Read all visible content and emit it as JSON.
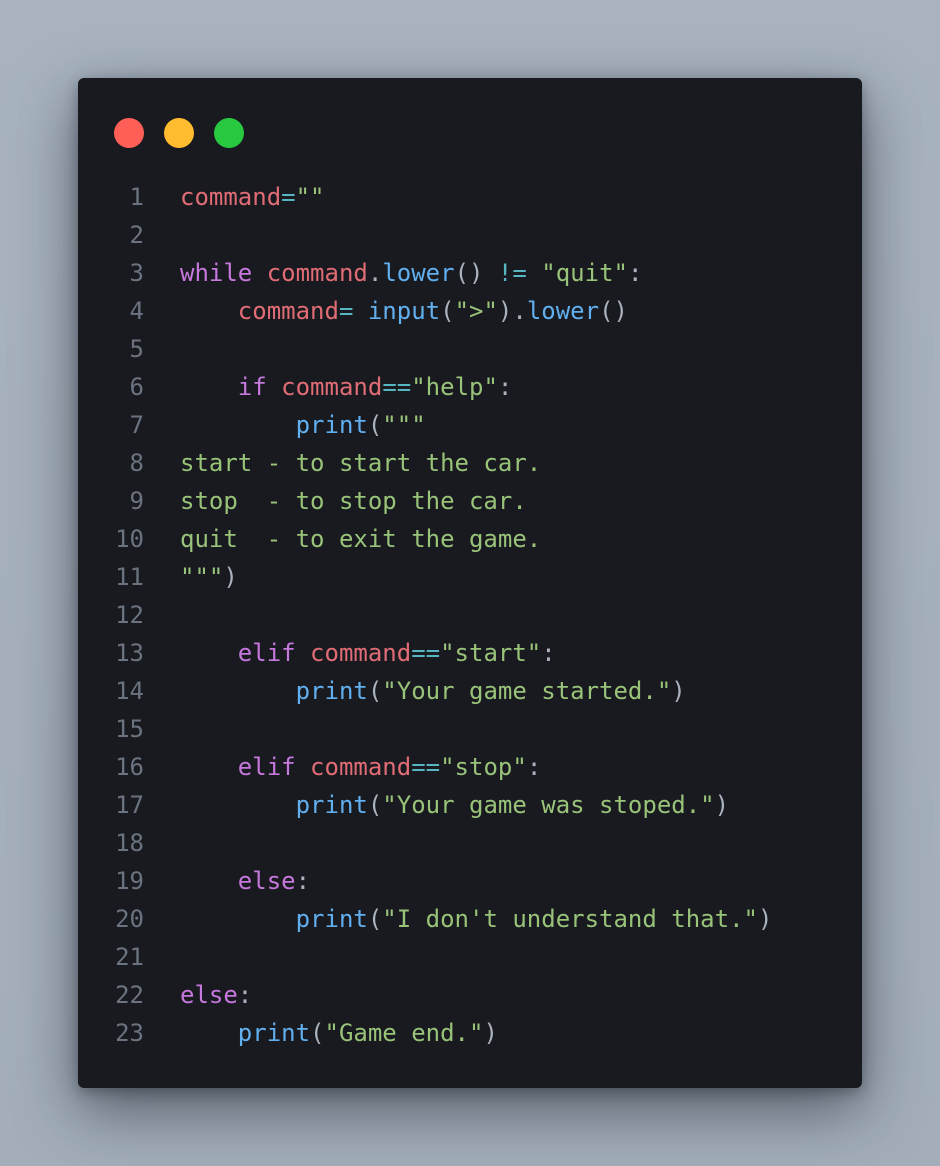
{
  "window": {
    "controls": [
      {
        "name": "close",
        "color": "#ff5f57"
      },
      {
        "name": "minimize",
        "color": "#febc2e"
      },
      {
        "name": "maximize",
        "color": "#28c840"
      }
    ]
  },
  "colors": {
    "background": "#a8b3bf",
    "editor_bg": "#181a1f",
    "line_number": "#6b7380",
    "keyword": "#c678dd",
    "variable": "#e06c75",
    "function": "#61afef",
    "string": "#98c379",
    "operator": "#56b6c2",
    "punctuation": "#abb2bf"
  },
  "code": {
    "language": "python",
    "lines": [
      {
        "n": "1",
        "tokens": [
          [
            "var",
            "command"
          ],
          [
            "op",
            "="
          ],
          [
            "str",
            "\"\""
          ]
        ]
      },
      {
        "n": "2",
        "tokens": []
      },
      {
        "n": "3",
        "tokens": [
          [
            "kw",
            "while"
          ],
          [
            "pn",
            " "
          ],
          [
            "var",
            "command"
          ],
          [
            "pn",
            "."
          ],
          [
            "fn",
            "lower"
          ],
          [
            "pn",
            "() "
          ],
          [
            "op",
            "!="
          ],
          [
            "pn",
            " "
          ],
          [
            "str",
            "\"quit\""
          ],
          [
            "pn",
            ":"
          ]
        ]
      },
      {
        "n": "4",
        "tokens": [
          [
            "pn",
            "    "
          ],
          [
            "var",
            "command"
          ],
          [
            "op",
            "="
          ],
          [
            "pn",
            " "
          ],
          [
            "fn",
            "input"
          ],
          [
            "pn",
            "("
          ],
          [
            "str",
            "\">\""
          ],
          [
            "pn",
            ")."
          ],
          [
            "fn",
            "lower"
          ],
          [
            "pn",
            "()"
          ]
        ]
      },
      {
        "n": "5",
        "tokens": []
      },
      {
        "n": "6",
        "tokens": [
          [
            "pn",
            "    "
          ],
          [
            "kw",
            "if"
          ],
          [
            "pn",
            " "
          ],
          [
            "var",
            "command"
          ],
          [
            "op",
            "=="
          ],
          [
            "str",
            "\"help\""
          ],
          [
            "pn",
            ":"
          ]
        ]
      },
      {
        "n": "7",
        "tokens": [
          [
            "pn",
            "        "
          ],
          [
            "fn",
            "print"
          ],
          [
            "pn",
            "("
          ],
          [
            "str",
            "\"\"\""
          ]
        ]
      },
      {
        "n": "8",
        "tokens": [
          [
            "str",
            "start - to start the car."
          ]
        ]
      },
      {
        "n": "9",
        "tokens": [
          [
            "str",
            "stop  - to stop the car."
          ]
        ]
      },
      {
        "n": "10",
        "tokens": [
          [
            "str",
            "quit  - to exit the game."
          ]
        ]
      },
      {
        "n": "11",
        "tokens": [
          [
            "str",
            "\"\"\""
          ],
          [
            "pn",
            ")"
          ]
        ]
      },
      {
        "n": "12",
        "tokens": []
      },
      {
        "n": "13",
        "tokens": [
          [
            "pn",
            "    "
          ],
          [
            "kw",
            "elif"
          ],
          [
            "pn",
            " "
          ],
          [
            "var",
            "command"
          ],
          [
            "op",
            "=="
          ],
          [
            "str",
            "\"start\""
          ],
          [
            "pn",
            ":"
          ]
        ]
      },
      {
        "n": "14",
        "tokens": [
          [
            "pn",
            "        "
          ],
          [
            "fn",
            "print"
          ],
          [
            "pn",
            "("
          ],
          [
            "str",
            "\"Your game started.\""
          ],
          [
            "pn",
            ")"
          ]
        ]
      },
      {
        "n": "15",
        "tokens": []
      },
      {
        "n": "16",
        "tokens": [
          [
            "pn",
            "    "
          ],
          [
            "kw",
            "elif"
          ],
          [
            "pn",
            " "
          ],
          [
            "var",
            "command"
          ],
          [
            "op",
            "=="
          ],
          [
            "str",
            "\"stop\""
          ],
          [
            "pn",
            ":"
          ]
        ]
      },
      {
        "n": "17",
        "tokens": [
          [
            "pn",
            "        "
          ],
          [
            "fn",
            "print"
          ],
          [
            "pn",
            "("
          ],
          [
            "str",
            "\"Your game was stoped.\""
          ],
          [
            "pn",
            ")"
          ]
        ]
      },
      {
        "n": "18",
        "tokens": []
      },
      {
        "n": "19",
        "tokens": [
          [
            "pn",
            "    "
          ],
          [
            "kw",
            "else"
          ],
          [
            "pn",
            ":"
          ]
        ]
      },
      {
        "n": "20",
        "tokens": [
          [
            "pn",
            "        "
          ],
          [
            "fn",
            "print"
          ],
          [
            "pn",
            "("
          ],
          [
            "str",
            "\"I don't understand that.\""
          ],
          [
            "pn",
            ")"
          ]
        ]
      },
      {
        "n": "21",
        "tokens": []
      },
      {
        "n": "22",
        "tokens": [
          [
            "kw",
            "else"
          ],
          [
            "pn",
            ":"
          ]
        ]
      },
      {
        "n": "23",
        "tokens": [
          [
            "pn",
            "    "
          ],
          [
            "fn",
            "print"
          ],
          [
            "pn",
            "("
          ],
          [
            "str",
            "\"Game end.\""
          ],
          [
            "pn",
            ")"
          ]
        ]
      }
    ]
  }
}
